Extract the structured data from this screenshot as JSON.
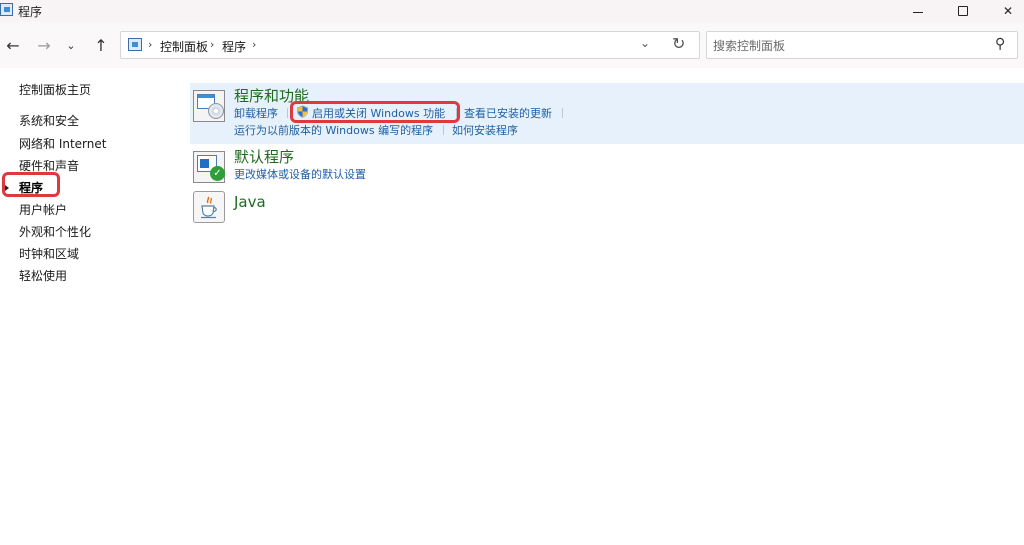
{
  "window": {
    "title": "程序",
    "minimize_glyph": "",
    "close_glyph": "✕"
  },
  "nav": {
    "back_glyph": "←",
    "forward_glyph": "→",
    "recent_glyph": "⌄",
    "up_glyph": "↑",
    "breadcrumb": [
      "控制面板",
      "程序"
    ],
    "breadcrumb_sep": "›",
    "dropdown_glyph": "⌄",
    "refresh_glyph": "↻",
    "search_placeholder": "搜索控制面板",
    "search_glyph": "⚲"
  },
  "sidebar": {
    "items": [
      {
        "label": "控制面板主页"
      },
      {
        "label": "系统和安全"
      },
      {
        "label": "网络和 Internet"
      },
      {
        "label": "硬件和声音"
      },
      {
        "label": "程序",
        "active": true
      },
      {
        "label": "用户帐户"
      },
      {
        "label": "外观和个性化"
      },
      {
        "label": "时钟和区域"
      },
      {
        "label": "轻松使用"
      }
    ]
  },
  "categories": [
    {
      "title": "程序和功能",
      "icon": "programs-icon",
      "selected": true,
      "links": [
        "卸载程序",
        "启用或关闭 Windows 功能",
        "查看已安装的更新",
        "运行为以前版本的 Windows 编写的程序",
        "如何安装程序"
      ]
    },
    {
      "title": "默认程序",
      "icon": "default-programs-icon",
      "links": [
        "更改媒体或设备的默认设置"
      ]
    },
    {
      "title": "Java",
      "icon": "java-icon",
      "links": []
    }
  ],
  "highlights": {
    "color": "#e0383e",
    "targets": [
      "sidebar-item-programs",
      "link-turn-windows-features"
    ]
  },
  "colors": {
    "link": "#1f5fa3",
    "category_title": "#1e6b1e",
    "selected_bg": "#e6f1fb"
  }
}
